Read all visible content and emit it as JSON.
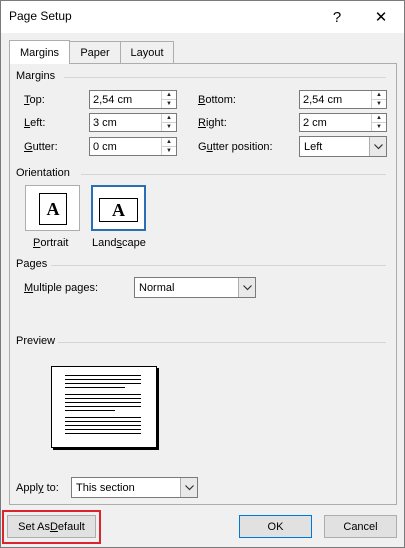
{
  "window": {
    "title": "Page Setup",
    "help": "?",
    "close": "✕"
  },
  "tabs": [
    {
      "label": "Margins",
      "active": true
    },
    {
      "label": "Paper",
      "active": false
    },
    {
      "label": "Layout",
      "active": false
    }
  ],
  "margins": {
    "group_label": "Margins",
    "top_label_mn": "T",
    "top_label_rest": "op:",
    "top_value": "2,54 cm",
    "bottom_label_mn": "B",
    "bottom_label_rest": "ottom:",
    "bottom_value": "2,54 cm",
    "left_label_mn": "L",
    "left_label_rest": "eft:",
    "left_value": "3 cm",
    "right_label_mn": "R",
    "right_label_rest": "ight:",
    "right_value": "2 cm",
    "gutter_label_mn": "G",
    "gutter_label_rest": "utter:",
    "gutter_value": "0 cm",
    "gutter_pos_label_pre": "G",
    "gutter_pos_label_mn": "u",
    "gutter_pos_label_rest": "tter position:",
    "gutter_pos_value": "Left"
  },
  "orientation": {
    "group_label": "Orientation",
    "icon_letter": "A",
    "portrait_label_mn": "P",
    "portrait_label_rest": "ortrait",
    "landscape_label_pre": "Land",
    "landscape_label_mn": "s",
    "landscape_label_rest": "cape",
    "selected": "Landscape"
  },
  "pages": {
    "group_label": "Pages",
    "multiple_label_mn": "M",
    "multiple_label_rest": "ultiple pages:",
    "multiple_value": "Normal"
  },
  "preview": {
    "group_label": "Preview"
  },
  "apply": {
    "label_pre": "Appl",
    "label_mn": "y",
    "label_rest": " to:",
    "value": "This section"
  },
  "buttons": {
    "default_pre": "Set As ",
    "default_mn": "D",
    "default_rest": "efault",
    "ok": "OK",
    "cancel": "Cancel"
  },
  "colors": {
    "highlight": "#d9262c",
    "selection": "#2a6fb6",
    "ok_border": "#0078d7"
  }
}
